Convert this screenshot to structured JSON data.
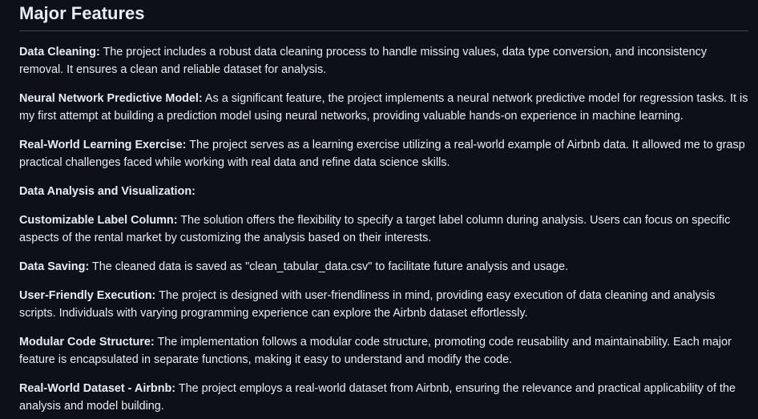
{
  "section": {
    "title": "Major Features"
  },
  "features": [
    {
      "label": "Data Cleaning:",
      "text": " The project includes a robust data cleaning process to handle missing values, data type conversion, and inconsistency removal. It ensures a clean and reliable dataset for analysis."
    },
    {
      "label": "Neural Network Predictive Model:",
      "text": " As a significant feature, the project implements a neural network predictive model for regression tasks. It is my first attempt at building a prediction model using neural networks, providing valuable hands-on experience in machine learning."
    },
    {
      "label": "Real-World Learning Exercise:",
      "text": " The project serves as a learning exercise utilizing a real-world example of Airbnb data. It allowed me to grasp practical challenges faced while working with real data and refine data science skills."
    },
    {
      "label": "Data Analysis and Visualization:",
      "text": ""
    },
    {
      "label": "Customizable Label Column:",
      "text": " The solution offers the flexibility to specify a target label column during analysis. Users can focus on specific aspects of the rental market by customizing the analysis based on their interests."
    },
    {
      "label": "Data Saving:",
      "text": " The cleaned data is saved as \"clean_tabular_data.csv\" to facilitate future analysis and usage."
    },
    {
      "label": "User-Friendly Execution:",
      "text": " The project is designed with user-friendliness in mind, providing easy execution of data cleaning and analysis scripts. Individuals with varying programming experience can explore the Airbnb dataset effortlessly."
    },
    {
      "label": "Modular Code Structure:",
      "text": " The implementation follows a modular code structure, promoting code reusability and maintainability. Each major feature is encapsulated in separate functions, making it easy to understand and modify the code."
    },
    {
      "label": "Real-World Dataset - Airbnb:",
      "text": " The project employs a real-world dataset from Airbnb, ensuring the relevance and practical applicability of the analysis and model building."
    }
  ]
}
